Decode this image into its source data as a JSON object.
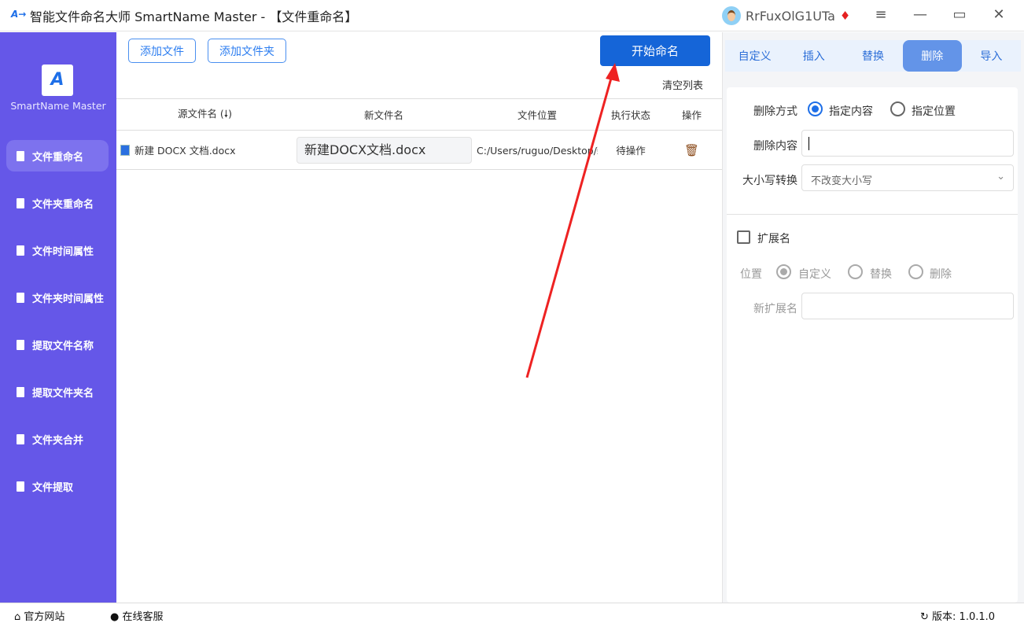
{
  "window": {
    "title": "智能文件命名大师 SmartName Master - 【文件重命名】",
    "username": "RrFuxOlG1UTa"
  },
  "sidebar": {
    "logo_text": "SmartName Master",
    "items": [
      {
        "label": "文件重命名",
        "active": true
      },
      {
        "label": "文件夹重命名"
      },
      {
        "label": "文件时间属性"
      },
      {
        "label": "文件夹时间属性"
      },
      {
        "label": "提取文件名称"
      },
      {
        "label": "提取文件夹名"
      },
      {
        "label": "文件夹合并"
      },
      {
        "label": "文件提取"
      }
    ]
  },
  "toolbar": {
    "add_file": "添加文件",
    "add_folder": "添加文件夹",
    "start": "开始命名",
    "clear": "清空列表"
  },
  "table": {
    "headers": [
      "源文件名 (🠗)",
      "新文件名",
      "文件位置",
      "执行状态",
      "操作"
    ],
    "rows": [
      {
        "source": "新建 DOCX 文档.docx",
        "new_name": "新建DOCX文档.docx",
        "location": "C:/Users/ruguo/Desktop/新",
        "status": "待操作"
      }
    ]
  },
  "right": {
    "tabs": [
      "自定义",
      "插入",
      "替换",
      "删除",
      "导入"
    ],
    "active_tab": "删除",
    "delete_mode_label": "删除方式",
    "mode_options": [
      "指定内容",
      "指定位置"
    ],
    "mode_selected": "指定内容",
    "delete_content_label": "删除内容",
    "delete_content_value": "",
    "case_label": "大小写转换",
    "case_value": "不改变大小写",
    "ext_label": "扩展名",
    "ext_checked": false,
    "position_label": "位置",
    "position_options": [
      "自定义",
      "替换",
      "删除"
    ],
    "position_selected": "自定义",
    "new_ext_label": "新扩展名",
    "new_ext_value": ""
  },
  "footer": {
    "website": "官方网站",
    "support": "在线客服",
    "version": "版本: 1.0.1.0"
  },
  "colors": {
    "sidebar": "#6557e8",
    "primary": "#1565d8",
    "annotation": "#ee2222"
  }
}
